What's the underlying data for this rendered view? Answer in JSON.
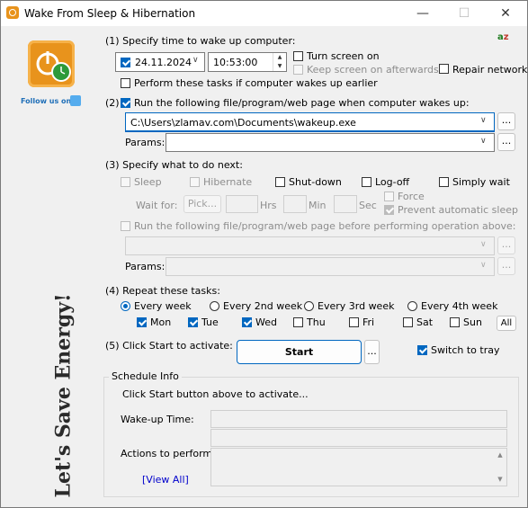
{
  "window": {
    "title": "Wake From Sleep & Hibernation",
    "minimize": "—",
    "maximize": "☐",
    "close": "✕"
  },
  "sidebar": {
    "follow_label": "Follow us on",
    "slogan": "Let's Save Energy!"
  },
  "section1": {
    "heading": "(1) Specify time to wake up computer:",
    "date": "24.11.2024",
    "time": "10:53:00",
    "turn_screen_on": "Turn screen on",
    "keep_screen": "Keep screen on afterwards",
    "repair_network": "Repair network",
    "perform_tasks": "Perform these tasks if computer wakes up earlier"
  },
  "section2": {
    "run_label": "Run the following file/program/web page when computer wakes up:",
    "path": "C:\\Users\\zlamav.com\\Documents\\wakeup.exe",
    "browse": "...",
    "params_label": "Params:",
    "params_value": "",
    "params_browse": "..."
  },
  "section3": {
    "heading": "(3) Specify what to do next:",
    "sleep": "Sleep",
    "hibernate": "Hibernate",
    "shutdown": "Shut-down",
    "logoff": "Log-off",
    "simply_wait": "Simply wait",
    "wait_for": "Wait for:",
    "pick": "Pick...",
    "hrs": "Hrs",
    "min": "Min",
    "sec": "Sec",
    "force": "Force",
    "prevent_sleep": "Prevent automatic sleep",
    "run_before": "Run the following file/program/web page before performing operation above:",
    "params_label": "Params:",
    "browse": "..."
  },
  "section4": {
    "heading": "(4) Repeat these tasks:",
    "every_week": "Every week",
    "every_2nd": "Every 2nd week",
    "every_3rd": "Every 3rd week",
    "every_4th": "Every 4th week",
    "days": [
      "Mon",
      "Tue",
      "Wed",
      "Thu",
      "Fri",
      "Sat",
      "Sun"
    ],
    "all_button": "All"
  },
  "section5": {
    "heading": "(5) Click Start to activate:",
    "start_button": "Start",
    "more_button": "...",
    "switch_tray": "Switch to tray"
  },
  "schedule": {
    "heading": "Schedule Info",
    "prompt": "Click Start button above to activate...",
    "wakeup_label": "Wake-up Time:",
    "actions_label": "Actions to perform:",
    "view_all": "[View All]"
  },
  "colors": {
    "accent": "#0067c0",
    "link": "#0000cc",
    "logo_orange": "#e8931c"
  }
}
